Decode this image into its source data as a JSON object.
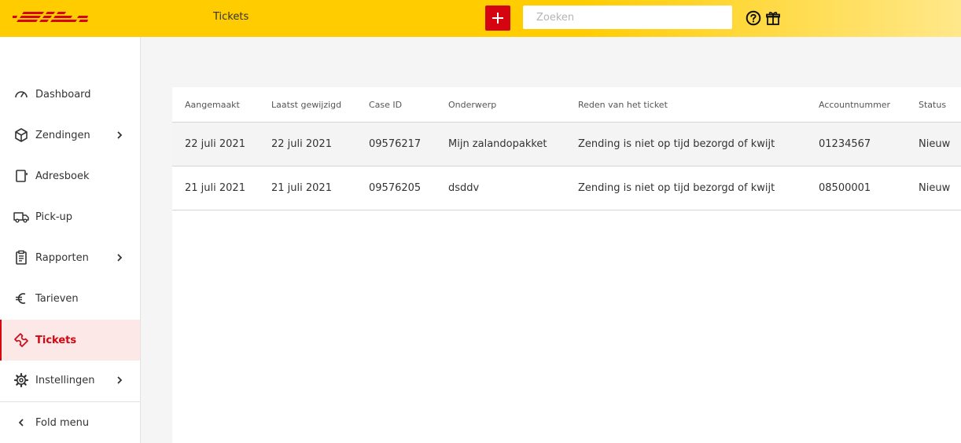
{
  "header": {
    "logo_text": "DHL",
    "page_label": "Tickets",
    "add_icon": "plus-icon",
    "search_placeholder": "Zoeken",
    "help_icon": "question-circle-icon",
    "gift_icon": "gift-icon",
    "brand_yellow": "#ffcc00",
    "brand_red": "#d40511"
  },
  "sidebar": {
    "items": [
      {
        "label": "Dashboard",
        "icon": "gauge-icon"
      },
      {
        "label": "Zendingen",
        "icon": "package-icon",
        "has_submenu": true
      },
      {
        "label": "Adresboek",
        "icon": "address-book-icon"
      },
      {
        "label": "Pick-up",
        "icon": "truck-icon"
      },
      {
        "label": "Rapporten",
        "icon": "clipboard-icon",
        "has_submenu": true
      },
      {
        "label": "Tarieven",
        "icon": "euro-icon"
      },
      {
        "label": "Tickets",
        "icon": "ticket-icon",
        "active": true
      },
      {
        "label": "Instellingen",
        "icon": "gear-icon",
        "has_submenu": true
      }
    ],
    "fold_label": "Fold menu"
  },
  "table": {
    "columns": [
      "Aangemaakt",
      "Laatst gewijzigd",
      "Case ID",
      "Onderwerp",
      "Reden van het ticket",
      "Accountnummer",
      "Status"
    ],
    "rows": [
      [
        "22 juli 2021",
        "22 juli 2021",
        "09576217",
        "Mijn zalandopakket",
        "Zending is niet op tijd bezorgd of kwijt",
        "01234567",
        "Nieuw"
      ],
      [
        "21 juli 2021",
        "21 juli 2021",
        "09576205",
        "dsddv",
        "Zending is niet op tijd bezorgd of kwijt",
        "08500001",
        "Nieuw"
      ]
    ]
  }
}
